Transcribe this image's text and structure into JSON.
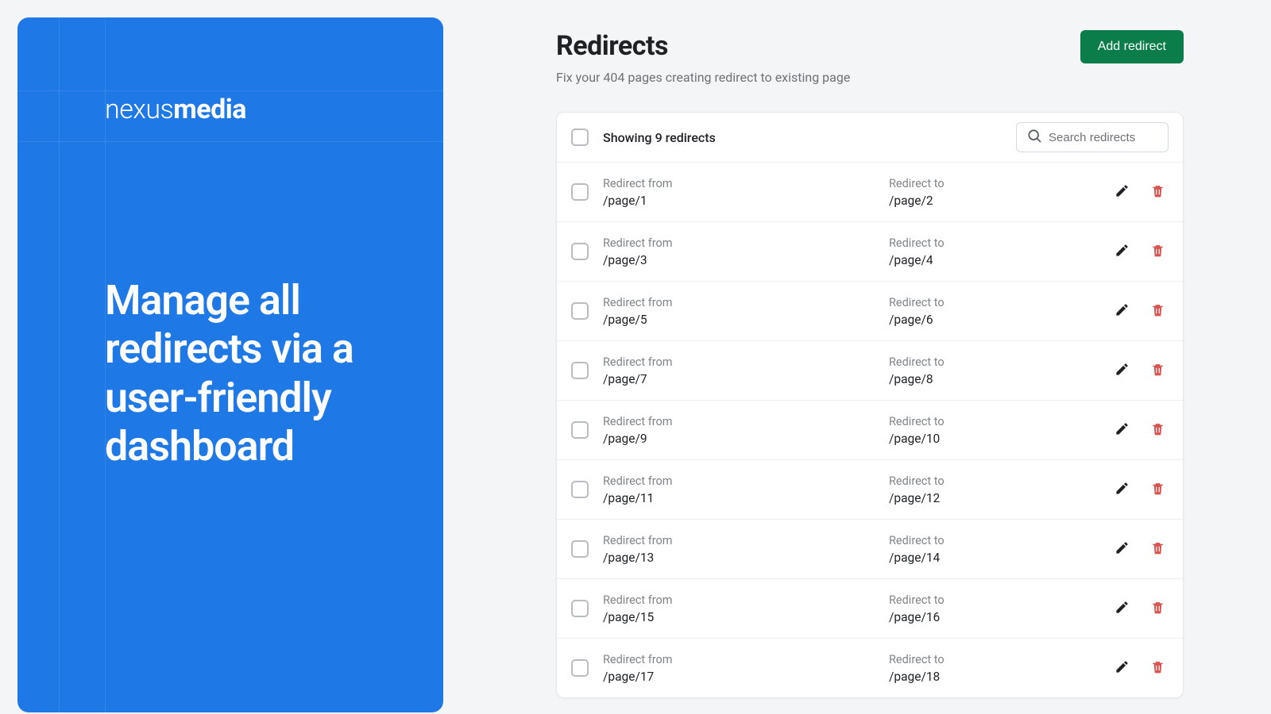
{
  "promo": {
    "logo_thin": "nexus",
    "logo_bold": "media",
    "heading": "Manage all redirects via a user-friendly dashboard"
  },
  "header": {
    "title": "Redirects",
    "subtitle": "Fix your 404 pages creating redirect to existing page",
    "add_button": "Add redirect"
  },
  "list": {
    "showing_text": "Showing 9 redirects",
    "search_placeholder": "Search redirects",
    "from_label": "Redirect from",
    "to_label": "Redirect to",
    "rows": [
      {
        "from": "/page/1",
        "to": "/page/2"
      },
      {
        "from": "/page/3",
        "to": "/page/4"
      },
      {
        "from": "/page/5",
        "to": "/page/6"
      },
      {
        "from": "/page/7",
        "to": "/page/8"
      },
      {
        "from": "/page/9",
        "to": "/page/10"
      },
      {
        "from": "/page/11",
        "to": "/page/12"
      },
      {
        "from": "/page/13",
        "to": "/page/14"
      },
      {
        "from": "/page/15",
        "to": "/page/16"
      },
      {
        "from": "/page/17",
        "to": "/page/18"
      }
    ]
  },
  "colors": {
    "accent_blue": "#1e78e6",
    "accent_green": "#0a7d4a",
    "danger_red": "#d9534f",
    "text_dark": "#1f2125",
    "text_muted": "#6e7175"
  }
}
